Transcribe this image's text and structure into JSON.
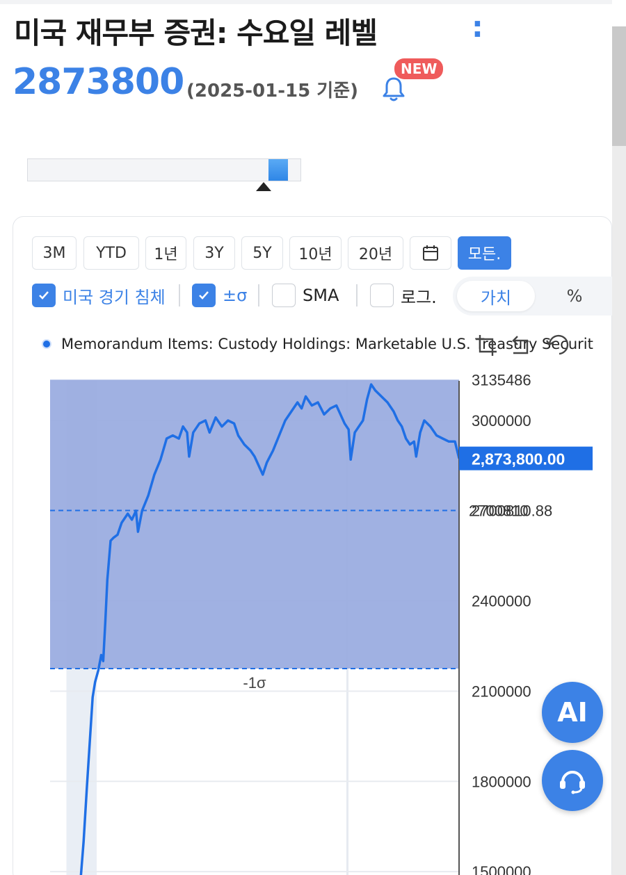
{
  "page": {
    "title": "미국 재무부 증권: 수요일 레벨",
    "title_more": ":",
    "value": "2873800",
    "as_of": "(2025-01-15 기준)",
    "badge": "NEW"
  },
  "ranges": [
    {
      "label": "3M",
      "active": false
    },
    {
      "label": "YTD",
      "active": false
    },
    {
      "label": "1년",
      "active": false
    },
    {
      "label": "3Y",
      "active": false
    },
    {
      "label": "5Y",
      "active": false
    },
    {
      "label": "10년",
      "active": false
    },
    {
      "label": "20년",
      "active": false
    },
    {
      "label": "",
      "icon": "calendar-icon",
      "active": false
    },
    {
      "label": "모든.",
      "active": true
    }
  ],
  "options": {
    "recession": "미국 경기 침체",
    "sigma": "±σ",
    "sma": "SMA",
    "log": "로그.",
    "value_toggle": "가치",
    "percent_toggle": "%"
  },
  "icons": {
    "bell": "bell-icon",
    "check": "check-icon",
    "crop": "crop-icon",
    "undo": "undo-icon",
    "reset": "reset-icon",
    "support": "headset-icon"
  },
  "fab": {
    "ai": "AI"
  },
  "colors": {
    "accent": "#3c82e6",
    "line": "#1f6fe5",
    "band": "#b9c6e9",
    "badge": "#ef5b5b"
  },
  "chart_data": {
    "type": "line",
    "legend": "Memorandum Items: Custody Holdings: Marketable U.S. Treasury Securities",
    "yticks": [
      3000000,
      2400000,
      2100000,
      1800000,
      1500000
    ],
    "ytick_labels": [
      "3000000",
      "2400000",
      "2100000",
      "1800000",
      "1500000"
    ],
    "max_label": "3135486",
    "current_value": 2873800,
    "current_label": "2,873,800.00",
    "mean_line": 2700810.88,
    "mean_line_label": "2700810.88",
    "upper_sigma_label": "2700810",
    "lower_sigma_value": 2175000,
    "lower_sigma_label": "-1σ",
    "ylim": [
      1460000,
      3135486
    ],
    "grid": true,
    "recession_shading": [
      {
        "x_start": 0.04,
        "x_end": 0.114
      }
    ],
    "series": [
      {
        "values": [
          [
            0.068,
            1400000
          ],
          [
            0.075,
            1480000
          ],
          [
            0.082,
            1600000
          ],
          [
            0.09,
            1780000
          ],
          [
            0.098,
            1950000
          ],
          [
            0.104,
            2080000
          ],
          [
            0.11,
            2130000
          ],
          [
            0.118,
            2170000
          ],
          [
            0.125,
            2220000
          ],
          [
            0.13,
            2200000
          ],
          [
            0.135,
            2330000
          ],
          [
            0.14,
            2470000
          ],
          [
            0.148,
            2600000
          ],
          [
            0.155,
            2610000
          ],
          [
            0.165,
            2620000
          ],
          [
            0.175,
            2660000
          ],
          [
            0.19,
            2690000
          ],
          [
            0.2,
            2670000
          ],
          [
            0.21,
            2700000
          ],
          [
            0.215,
            2630000
          ],
          [
            0.225,
            2700000
          ],
          [
            0.24,
            2750000
          ],
          [
            0.255,
            2820000
          ],
          [
            0.27,
            2870000
          ],
          [
            0.285,
            2940000
          ],
          [
            0.3,
            2950000
          ],
          [
            0.315,
            2940000
          ],
          [
            0.325,
            2980000
          ],
          [
            0.335,
            2960000
          ],
          [
            0.34,
            2880000
          ],
          [
            0.35,
            2960000
          ],
          [
            0.365,
            2990000
          ],
          [
            0.38,
            3000000
          ],
          [
            0.39,
            2960000
          ],
          [
            0.405,
            3010000
          ],
          [
            0.42,
            2980000
          ],
          [
            0.435,
            3000000
          ],
          [
            0.45,
            2990000
          ],
          [
            0.46,
            2950000
          ],
          [
            0.475,
            2920000
          ],
          [
            0.49,
            2900000
          ],
          [
            0.5,
            2880000
          ],
          [
            0.51,
            2850000
          ],
          [
            0.52,
            2820000
          ],
          [
            0.53,
            2860000
          ],
          [
            0.545,
            2900000
          ],
          [
            0.56,
            2950000
          ],
          [
            0.575,
            3000000
          ],
          [
            0.59,
            3030000
          ],
          [
            0.605,
            3060000
          ],
          [
            0.615,
            3040000
          ],
          [
            0.625,
            3080000
          ],
          [
            0.64,
            3050000
          ],
          [
            0.655,
            3060000
          ],
          [
            0.67,
            3020000
          ],
          [
            0.685,
            3040000
          ],
          [
            0.7,
            3050000
          ],
          [
            0.71,
            3020000
          ],
          [
            0.72,
            2990000
          ],
          [
            0.73,
            2970000
          ],
          [
            0.735,
            2870000
          ],
          [
            0.745,
            2960000
          ],
          [
            0.755,
            2980000
          ],
          [
            0.765,
            3000000
          ],
          [
            0.775,
            3070000
          ],
          [
            0.785,
            3120000
          ],
          [
            0.795,
            3100000
          ],
          [
            0.81,
            3080000
          ],
          [
            0.825,
            3060000
          ],
          [
            0.84,
            3030000
          ],
          [
            0.85,
            3000000
          ],
          [
            0.86,
            2980000
          ],
          [
            0.87,
            2940000
          ],
          [
            0.88,
            2920000
          ],
          [
            0.89,
            2930000
          ],
          [
            0.895,
            2880000
          ],
          [
            0.905,
            2960000
          ],
          [
            0.915,
            3000000
          ],
          [
            0.93,
            2980000
          ],
          [
            0.945,
            2950000
          ],
          [
            0.96,
            2940000
          ],
          [
            0.975,
            2930000
          ],
          [
            0.99,
            2930000
          ],
          [
            1.0,
            2873800
          ]
        ]
      }
    ]
  }
}
